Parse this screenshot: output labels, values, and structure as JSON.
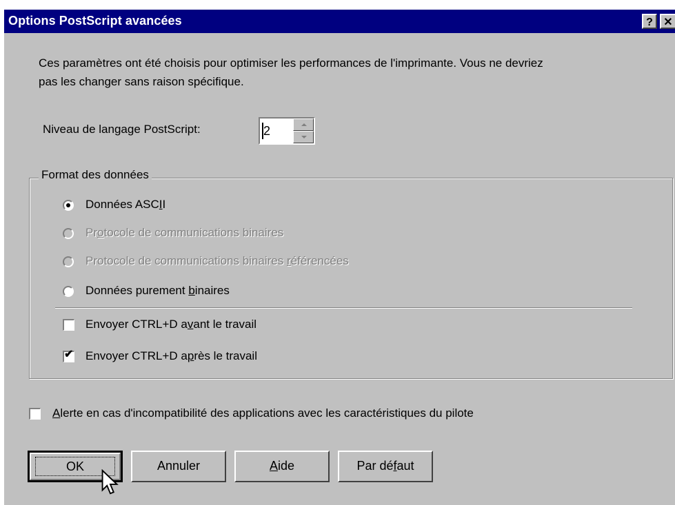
{
  "window": {
    "title": "Options PostScript avancées",
    "help_glyph": "?",
    "close_glyph": "✕"
  },
  "intro": {
    "line1": "Ces paramètres ont été choisis pour optimiser les performances de l'imprimante. Vous ne devriez",
    "line2": "pas les changer sans raison spécifique."
  },
  "language_level": {
    "label": "Niveau de langage PostScript:",
    "value": "2"
  },
  "data_format": {
    "legend": "Format des données",
    "options": [
      {
        "pre": "Données ASC",
        "ul": "I",
        "post": "I",
        "selected": true,
        "enabled": true
      },
      {
        "pre": "Pr",
        "ul": "o",
        "post": "tocole de communications binaires",
        "selected": false,
        "enabled": false
      },
      {
        "pre": "Protocole de communications binaires ",
        "ul": "r",
        "post": "éférencées",
        "selected": false,
        "enabled": false
      },
      {
        "pre": "Données purement ",
        "ul": "b",
        "post": "inaires",
        "selected": false,
        "enabled": true
      }
    ],
    "ctrl_before": {
      "pre": "Envoyer CTRL+D a",
      "ul": "v",
      "post": "ant le travail",
      "checked": false
    },
    "ctrl_after": {
      "pre": "Envoyer CTRL+D a",
      "ul": "p",
      "post": "rès le travail",
      "checked": true
    }
  },
  "alert": {
    "pre": "",
    "ul": "A",
    "post": "lerte en cas d'incompatibilité des applications avec les caractéristiques du pilote",
    "checked": false
  },
  "buttons": {
    "ok": "OK",
    "cancel": "Annuler",
    "help": {
      "pre": "",
      "ul": "A",
      "post": "ide"
    },
    "default": {
      "pre": "Par dé",
      "ul": "f",
      "post": "aut"
    }
  },
  "check_glyph": "✔"
}
